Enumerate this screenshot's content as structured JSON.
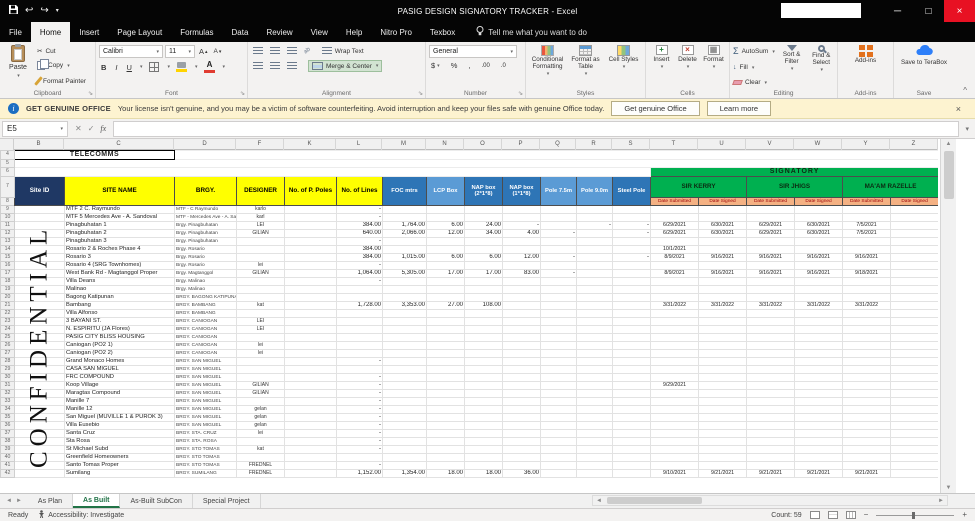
{
  "titlebar": {
    "title": "PASIG DESIGN SIGNATORY TRACKER  -  Excel"
  },
  "ribbon_tabs": {
    "items": [
      "File",
      "Home",
      "Insert",
      "Page Layout",
      "Formulas",
      "Data",
      "Review",
      "View",
      "Help",
      "Nitro Pro",
      "Texbox"
    ],
    "active": "Home",
    "tell_me": "Tell me what you want to do"
  },
  "ribbon": {
    "paste": "Paste",
    "cut": "Cut",
    "copy": "Copy",
    "format_painter": "Format Painter",
    "clipboard_group": "Clipboard",
    "font_name": "Calibri",
    "font_size": "11",
    "font_group": "Font",
    "wrap_text": "Wrap Text",
    "merge_center": "Merge & Center",
    "alignment_group": "Alignment",
    "number_format": "General",
    "number_group": "Number",
    "conditional_formatting": "Conditional Formatting",
    "format_as_table": "Format as Table",
    "cell_styles": "Cell Styles",
    "styles_group": "Styles",
    "insert": "Insert",
    "delete": "Delete",
    "format": "Format",
    "cells_group": "Cells",
    "autosum": "AutoSum",
    "fill": "Fill",
    "clear": "Clear",
    "sort_filter": "Sort & Filter",
    "find_select": "Find & Select",
    "editing_group": "Editing",
    "addins": "Add-ins",
    "addins_group": "Add-ins",
    "save_terabox": "Save to TeraBox",
    "save_group": "Save"
  },
  "notice": {
    "badge": "GET GENUINE OFFICE",
    "message": "Your license isn't genuine, and you may be a victim of software counterfeiting. Avoid interruption and keep your files safe with genuine Office today.",
    "get_genuine": "Get genuine Office",
    "learn_more": "Learn more"
  },
  "formula_bar": {
    "name_box": "E5",
    "fx": "fx",
    "formula": ""
  },
  "sheet": {
    "column_letters": [
      "B",
      "C",
      "D",
      "F",
      "K",
      "L",
      "M",
      "N",
      "O",
      "P",
      "Q",
      "R",
      "S",
      "T",
      "U",
      "V",
      "W",
      "Y",
      "Z"
    ],
    "telecomms": "TELECOMMS",
    "confidential": "CONFIDENTIAL",
    "signatory": "SIGNATORY",
    "headers": [
      "Site ID",
      "SITE NAME",
      "BRGY.",
      "DESIGNER",
      "No. of P. Poles",
      "No. of Lines",
      "FOC mtrs",
      "LCP Box",
      "NAP box (2*1*8)",
      "NAP box (1*1*8)",
      "Pole 7.5m",
      "Pole 9.0m",
      "Steel Pole"
    ],
    "signers": [
      "SIR KERRY",
      "SIR JHIGS",
      "MA'AM RAZELLE"
    ],
    "date_headers": [
      "Date Submitted",
      "Date Signed"
    ],
    "rows": [
      [
        "",
        "MTF 2 C. Raymundo",
        "MTF - C Raymundo",
        "karlo",
        "",
        "-",
        "",
        "",
        "",
        "",
        "",
        "",
        "",
        "",
        "",
        "",
        "",
        "",
        ""
      ],
      [
        "",
        "MTF 5 Mercedes Ave - A. Sandoval",
        "MTF - Mercedes Ave - A. Sandoval",
        "karl",
        "",
        "-",
        "",
        "",
        "",
        "",
        "",
        "",
        "",
        "",
        "",
        "",
        "",
        "",
        ""
      ],
      [
        "",
        "Pinagbuhatan 1",
        "Brgy. Pinagbuhatan",
        "LEI",
        "",
        "384.00",
        "1,764.00",
        "6.00",
        "24.00",
        "-",
        "",
        "-",
        "-",
        "6/29/2021",
        "6/30/2021",
        "6/29/2021",
        "6/30/2021",
        "7/5/2021",
        ""
      ],
      [
        "",
        "Pinagbuhatan 2",
        "Brgy. Pinagbuhatan",
        "GILIAN",
        "",
        "640.00",
        "2,066.00",
        "12.00",
        "34.00",
        "4.00",
        "-",
        "",
        "-",
        "6/29/2021",
        "6/30/2021",
        "6/29/2021",
        "6/30/2021",
        "7/5/2021",
        ""
      ],
      [
        "",
        "Pinagbuhatan 3",
        "Brgy. Pinagbuhatan",
        "",
        "",
        "-",
        "",
        "",
        "",
        "",
        "",
        "",
        "",
        "",
        "",
        "",
        "",
        "",
        ""
      ],
      [
        "",
        "Rosario 2 & Roches Phase 4",
        "Brgy. Rosario",
        "",
        "",
        "384.00",
        "",
        "",
        "",
        "",
        "",
        "",
        "",
        "10/1/2021",
        "",
        "",
        "",
        "",
        ""
      ],
      [
        "",
        "Rosario 3",
        "Brgy. Rosario",
        "",
        "",
        "384.00",
        "1,015.00",
        "6.00",
        "6.00",
        "12.00",
        "-",
        "",
        "-",
        "8/9/2021",
        "9/16/2021",
        "9/16/2021",
        "9/16/2021",
        "9/16/2021",
        ""
      ],
      [
        "",
        "Rosario 4 (SRG Townhomes)",
        "Brgy. Rosario",
        "lei",
        "",
        "-",
        "",
        "",
        "",
        "",
        "",
        "",
        "",
        "",
        "",
        "",
        "",
        "",
        ""
      ],
      [
        "",
        "West Bank Rd - Magtanggol Proper",
        "Brgy. Magtanggol",
        "GILIAN",
        "",
        "1,064.00",
        "5,305.00",
        "17.00",
        "17.00",
        "83.00",
        "-",
        "",
        "",
        "8/9/2021",
        "9/16/2021",
        "9/16/2021",
        "9/16/2021",
        "9/18/2021",
        ""
      ],
      [
        "",
        "Villa Deans",
        "Brgy. Malinao",
        "",
        "",
        "-",
        "",
        "",
        "",
        "",
        "",
        "",
        "",
        "",
        "",
        "",
        "",
        "",
        ""
      ],
      [
        "",
        "Malinao",
        "Brgy. Malinao",
        "",
        "",
        "",
        "",
        "",
        "",
        "",
        "",
        "",
        "",
        "",
        "",
        "",
        "",
        "",
        ""
      ],
      [
        "",
        "Bagong Katipunan",
        "BRGY. BAGONG KATIPUNAN",
        "",
        "",
        "",
        "",
        "",
        "",
        "",
        "",
        "",
        "",
        "",
        "",
        "",
        "",
        "",
        ""
      ],
      [
        "",
        "Bambang",
        "BRGY. BAMBANG",
        "kat",
        "",
        "1,728.00",
        "3,353.00",
        "27.00",
        "108.00",
        "",
        "",
        "",
        "",
        "3/31/2022",
        "3/31/2022",
        "3/31/2022",
        "3/31/2022",
        "3/31/2022",
        ""
      ],
      [
        "",
        "Villa Alfonso",
        "BRGY. BAMBANG",
        "",
        "",
        "",
        "",
        "",
        "",
        "",
        "",
        "",
        "",
        "",
        "",
        "",
        "",
        "",
        ""
      ],
      [
        "",
        "3 BAYANI ST.",
        "BRGY. CANIOGAN",
        "LEI",
        "",
        "",
        "",
        "",
        "",
        "",
        "",
        "",
        "",
        "",
        "",
        "",
        "",
        "",
        ""
      ],
      [
        "",
        "N. ESPIRITU (JA Flores)",
        "BRGY. CANIOGAN",
        "LEI",
        "",
        "",
        "",
        "",
        "",
        "",
        "",
        "",
        "",
        "",
        "",
        "",
        "",
        "",
        ""
      ],
      [
        "",
        "PASIG CITY BLISS HOUSING",
        "BRGY. CANIOGAN",
        "",
        "",
        "",
        "",
        "",
        "",
        "",
        "",
        "",
        "",
        "",
        "",
        "",
        "",
        "",
        ""
      ],
      [
        "",
        "Caniogan (PO2 1)",
        "BRGY. CANIOGAN",
        "lei",
        "",
        "",
        "",
        "",
        "",
        "",
        "",
        "",
        "",
        "",
        "",
        "",
        "",
        "",
        ""
      ],
      [
        "",
        "Caniogan (PO2 2)",
        "BRGY. CANIOGAN",
        "lei",
        "",
        "",
        "",
        "",
        "",
        "",
        "",
        "",
        "",
        "",
        "",
        "",
        "",
        "",
        ""
      ],
      [
        "",
        "Grand Monaco Homes",
        "BRGY. SAN MIGUEL",
        "",
        "",
        "-",
        "",
        "",
        "",
        "",
        "",
        "",
        "",
        "",
        "",
        "",
        "",
        "",
        ""
      ],
      [
        "",
        "CASA SAN MIGUEL",
        "BRGY. SAN MIGUEL",
        "",
        "",
        "",
        "",
        "",
        "",
        "",
        "",
        "",
        "",
        "",
        "",
        "",
        "",
        "",
        ""
      ],
      [
        "",
        "FRC COMPOUND",
        "BRGY. SAN MIGUEL",
        "",
        "",
        "-",
        "",
        "",
        "",
        "",
        "",
        "",
        "",
        "",
        "",
        "",
        "",
        "",
        ""
      ],
      [
        "",
        "Koop Village",
        "BRGY. SAN MIGUEL",
        "GILIAN",
        "",
        "-",
        "",
        "",
        "",
        "",
        "",
        "",
        "",
        "9/29/2021",
        "",
        "",
        "",
        "",
        ""
      ],
      [
        "",
        "Maragtas Compound",
        "BRGY. SAN MIGUEL",
        "GILIAN",
        "",
        "-",
        "",
        "",
        "",
        "",
        "",
        "",
        "",
        "",
        "",
        "",
        "",
        "",
        ""
      ],
      [
        "",
        "Manille 7",
        "BRGY. SAN MIGUEL",
        "",
        "",
        "-",
        "",
        "",
        "",
        "",
        "",
        "",
        "",
        "",
        "",
        "",
        "",
        "",
        ""
      ],
      [
        "",
        "Manille 12",
        "BRGY. SAN MIGUEL",
        "gelan",
        "",
        "-",
        "",
        "",
        "",
        "",
        "",
        "",
        "",
        "",
        "",
        "",
        "",
        "",
        ""
      ],
      [
        "",
        "San Miguel (MUVILLE 1 & PUROK 3)",
        "BRGY. SAN MIGUEL",
        "gelan",
        "",
        "-",
        "",
        "",
        "",
        "",
        "",
        "",
        "",
        "",
        "",
        "",
        "",
        "",
        ""
      ],
      [
        "",
        "Villa Eusebio",
        "BRGY. SAN MIGUEL",
        "gelan",
        "",
        "-",
        "",
        "",
        "",
        "",
        "",
        "",
        "",
        "",
        "",
        "",
        "",
        "",
        ""
      ],
      [
        "",
        "Santa Cruz",
        "BRGY. STA. CRUZ",
        "lei",
        "",
        "-",
        "",
        "",
        "",
        "",
        "",
        "",
        "",
        "",
        "",
        "",
        "",
        "",
        ""
      ],
      [
        "",
        "Sta Rosa",
        "BRGY. STA. ROSA",
        "",
        "",
        "-",
        "",
        "",
        "",
        "",
        "",
        "",
        "",
        "",
        "",
        "",
        "",
        "",
        ""
      ],
      [
        "",
        "St Michael Subd",
        "BRGY. STO TOMAS",
        "kat",
        "",
        "-",
        "",
        "",
        "",
        "",
        "",
        "",
        "",
        "",
        "",
        "",
        "",
        "",
        ""
      ],
      [
        "",
        "Greenfield Homeowners",
        "BRGY. STO TOMAS",
        "",
        "",
        "",
        "",
        "",
        "",
        "",
        "",
        "",
        "",
        "",
        "",
        "",
        "",
        "",
        ""
      ],
      [
        "",
        "Santo Tomas Proper",
        "BRGY. STO TOMAS",
        "FREDNEL",
        "",
        "-",
        "",
        "",
        "",
        "",
        "",
        "",
        "",
        "",
        "",
        "",
        "",
        "",
        ""
      ],
      [
        "",
        "Sumilang",
        "BRGY. SUMILANG",
        "FREDNEL",
        "",
        "1,152.00",
        "1,354.00",
        "18.00",
        "18.00",
        "36.00",
        "",
        "",
        "",
        "9/10/2021",
        "9/21/2021",
        "9/21/2021",
        "9/21/2021",
        "9/21/2021",
        ""
      ]
    ]
  },
  "sheet_tabs": {
    "items": [
      "As Plan",
      "As Built",
      "As-Built SubCon",
      "Special Project"
    ],
    "active": "As Built"
  },
  "status_bar": {
    "ready": "Ready",
    "accessibility": "Accessibility: Investigate",
    "count": "Count: 59"
  },
  "colors": {
    "signatory_green": "#00b050",
    "header_yellow": "#ffff00",
    "header_blue": "#2e75b6",
    "header_blue_light": "#5b9bd5",
    "header_navy": "#1f3864",
    "close_red": "#e81123",
    "titlebar": "#050505",
    "notice_yellow": "#fdf3d0"
  }
}
